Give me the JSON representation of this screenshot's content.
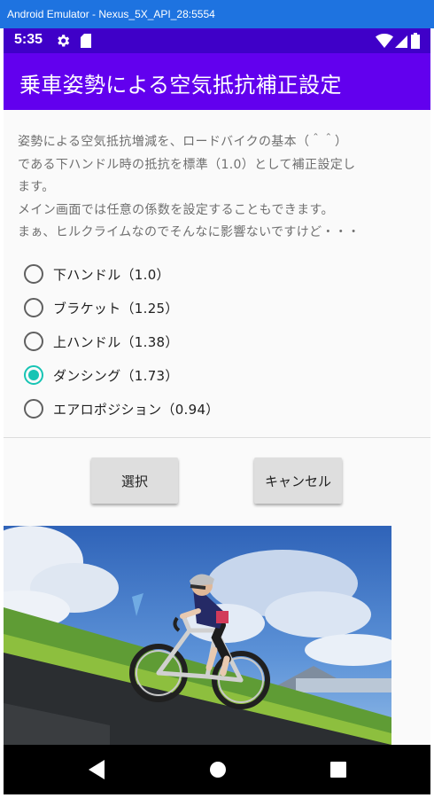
{
  "window": {
    "title": "Android Emulator - Nexus_5X_API_28:5554"
  },
  "status_bar": {
    "time": "5:35",
    "icons": [
      "gear-icon",
      "sd-card-icon",
      "wifi-icon",
      "signal-icon",
      "battery-icon"
    ],
    "background": "#3f00c8"
  },
  "app_bar": {
    "title": "乗車姿勢による空気抵抗補正設定",
    "background": "#6200ee"
  },
  "description": {
    "lines": [
      "姿勢による空気抵抗増減を、ロードバイクの基本（＾＾）",
      "である下ハンドル時の抵抗を標準（1.0）として補正設定し",
      "ます。",
      "メイン画面では任意の係数を設定することもできます。",
      "まぁ、ヒルクライムなのでそんなに影響ないですけど・・・"
    ]
  },
  "options": [
    {
      "label": "下ハンドル（1.0）",
      "checked": false
    },
    {
      "label": "ブラケット（1.25）",
      "checked": false
    },
    {
      "label": "上ハンドル（1.38）",
      "checked": false
    },
    {
      "label": "ダンシング（1.73）",
      "checked": true
    },
    {
      "label": "エアロポジション（0.94）",
      "checked": false
    }
  ],
  "buttons": {
    "select": "選択",
    "cancel": "キャンセル"
  },
  "accent_color": "#17c4b4",
  "nav_bar": {
    "icons": [
      "back-icon",
      "home-icon",
      "recents-icon"
    ]
  }
}
